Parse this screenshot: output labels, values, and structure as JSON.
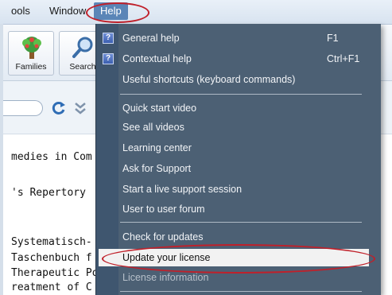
{
  "menubar": {
    "items": [
      "ools",
      "Window",
      "Help"
    ]
  },
  "toolbar": {
    "buttons": [
      {
        "label": "Families",
        "icon": "family-tree-icon"
      },
      {
        "label": "Search",
        "icon": "magnifier-icon"
      }
    ]
  },
  "search_row": {
    "icons": [
      "refresh-icon",
      "double-chevron-down-icon"
    ]
  },
  "document": {
    "lines": [
      "medies in Com",
      "'s Repertory",
      "Systematisch-",
      "Taschenbuch f",
      "Therapeutic Po",
      "reatment of C"
    ]
  },
  "help_menu": {
    "items": [
      {
        "label": "General help",
        "shortcut": "F1",
        "icon": "help-book-icon"
      },
      {
        "label": "Contextual help",
        "shortcut": "Ctrl+F1",
        "icon": "help-book-icon"
      },
      {
        "label": "Useful shortcuts (keyboard commands)",
        "shortcut": ""
      },
      {
        "label": "Quick start video",
        "shortcut": ""
      },
      {
        "label": "See all videos",
        "shortcut": ""
      },
      {
        "label": "Learning center",
        "shortcut": ""
      },
      {
        "label": "Ask for Support",
        "shortcut": ""
      },
      {
        "label": "Start a live support session",
        "shortcut": ""
      },
      {
        "label": "User to user forum",
        "shortcut": ""
      },
      {
        "label": "Check for updates",
        "shortcut": ""
      },
      {
        "label": "Update your license",
        "shortcut": ""
      },
      {
        "label": "License information",
        "shortcut": ""
      }
    ]
  },
  "colors": {
    "annotation_red": "#c0202a",
    "menu_bg": "#4c6074",
    "highlight_bg": "#f2f2f2",
    "active_menu": "#5a85b7"
  }
}
